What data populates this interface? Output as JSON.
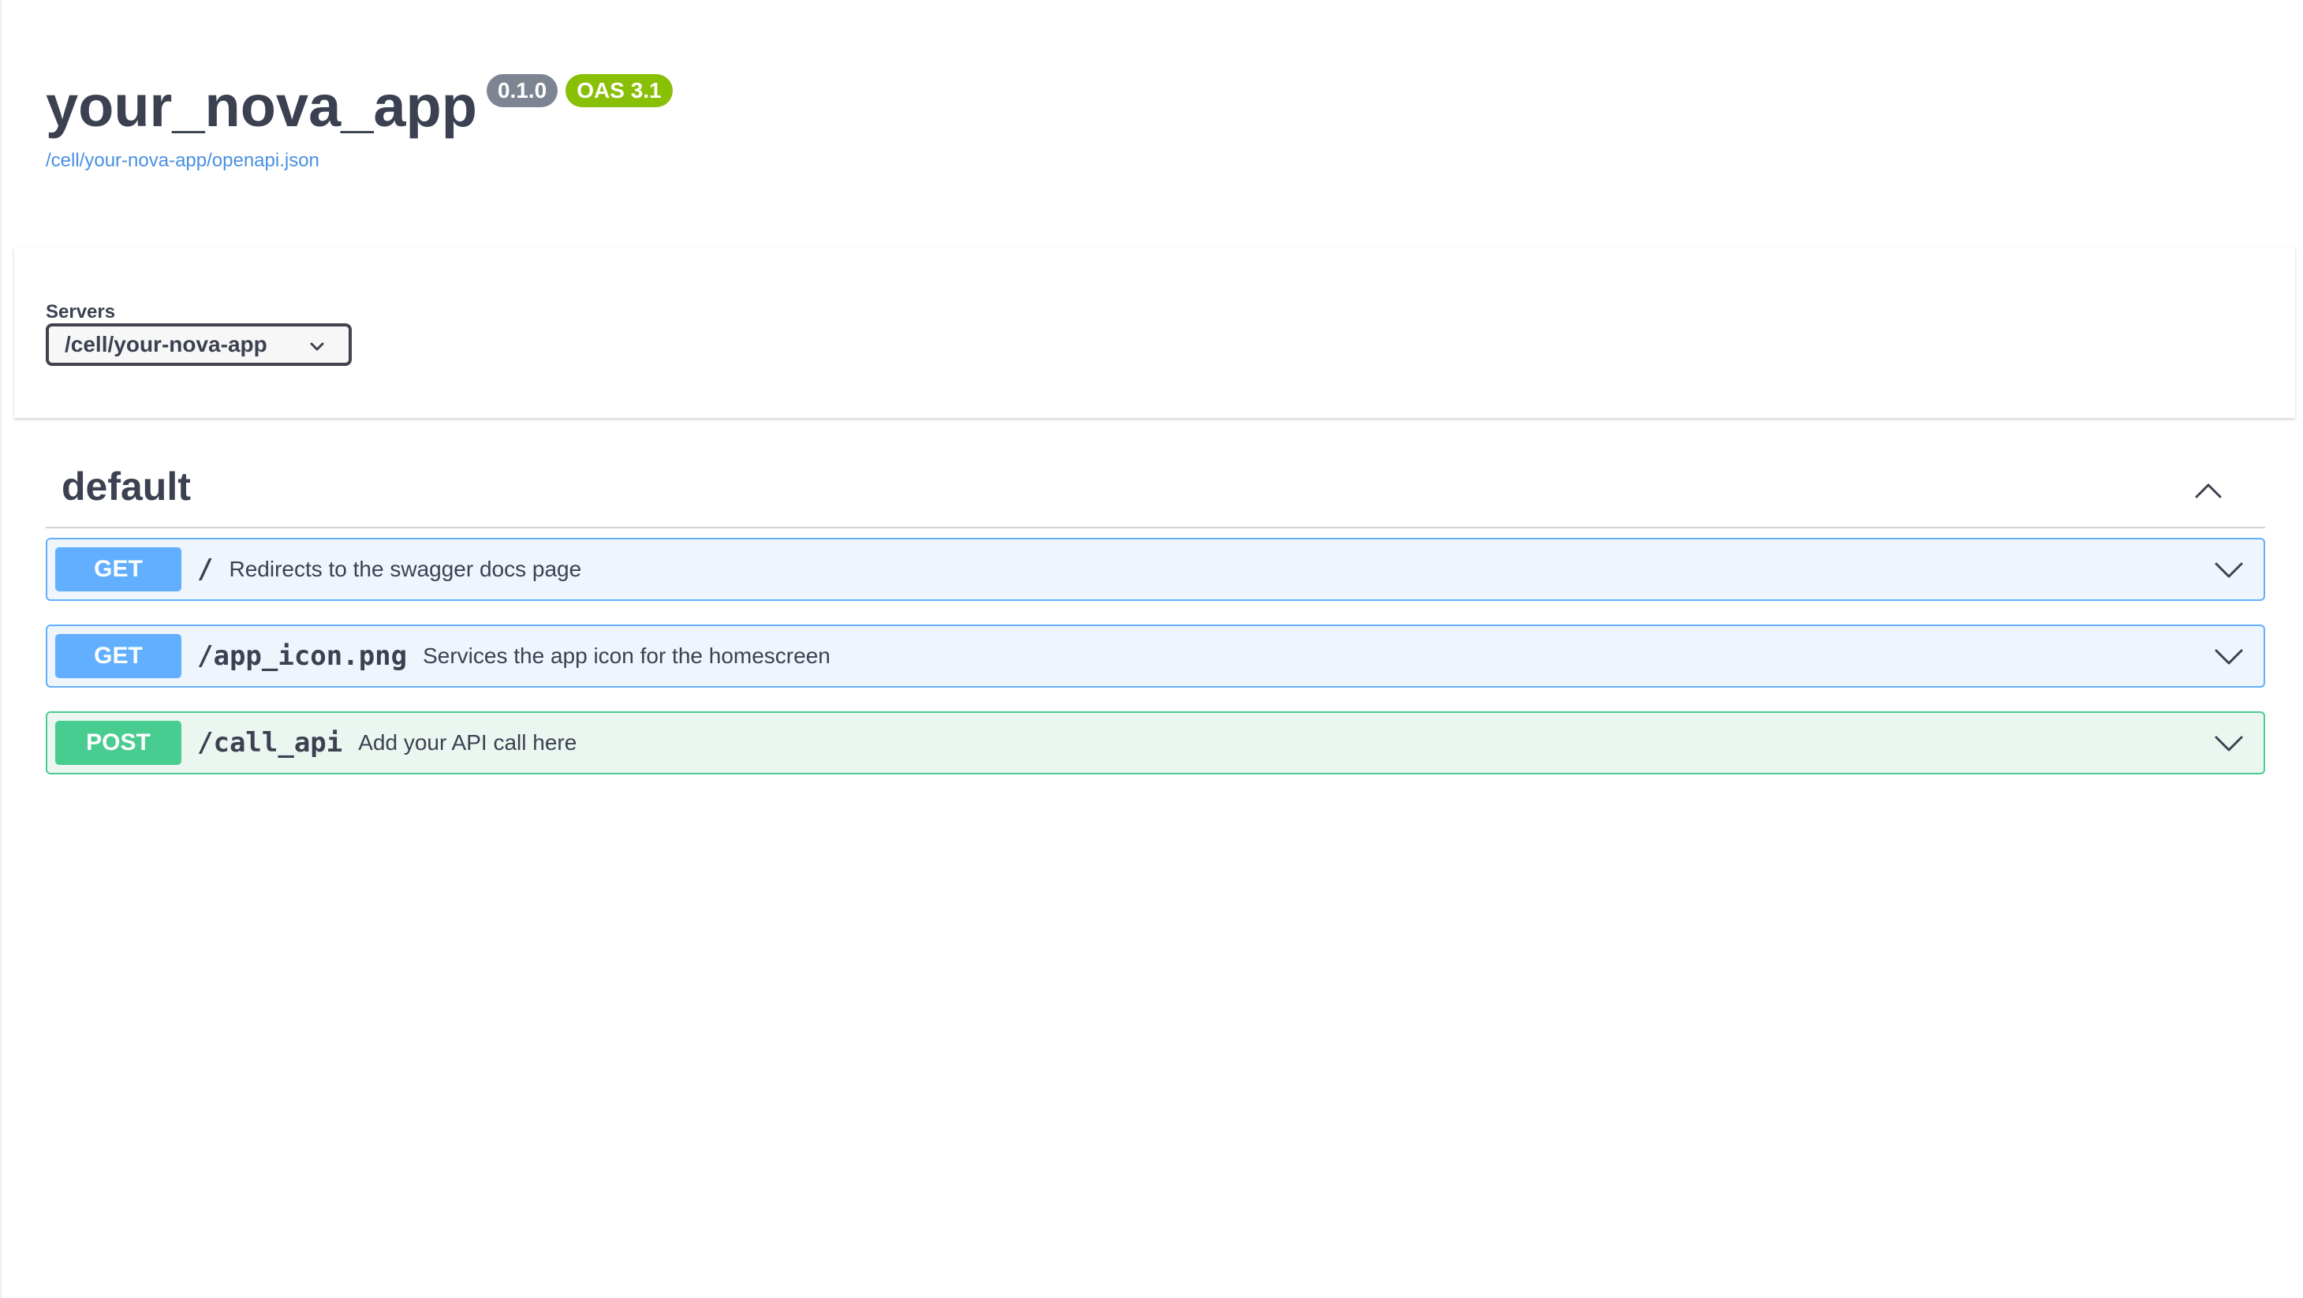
{
  "info": {
    "title": "your_nova_app",
    "version": "0.1.0",
    "oas": "OAS 3.1",
    "spec_url": "/cell/your-nova-app/openapi.json"
  },
  "servers": {
    "label": "Servers",
    "selected": "/cell/your-nova-app"
  },
  "tag": {
    "name": "default"
  },
  "operations": [
    {
      "method": "GET",
      "path": "/",
      "summary": "Redirects to the swagger docs page"
    },
    {
      "method": "GET",
      "path": "/app_icon.png",
      "summary": "Services the app icon for the homescreen"
    },
    {
      "method": "POST",
      "path": "/call_api",
      "summary": "Add your API call here"
    }
  ],
  "colors": {
    "get": "#61affe",
    "post": "#49cc90",
    "version_badge": "#7d8492",
    "oas_badge": "#89bf04",
    "link": "#4990e2",
    "text": "#3b4151"
  },
  "icons": {
    "select_arrow": "chevron-down-icon",
    "tag_toggle": "chevron-up-icon",
    "op_expand": "chevron-down-icon"
  }
}
